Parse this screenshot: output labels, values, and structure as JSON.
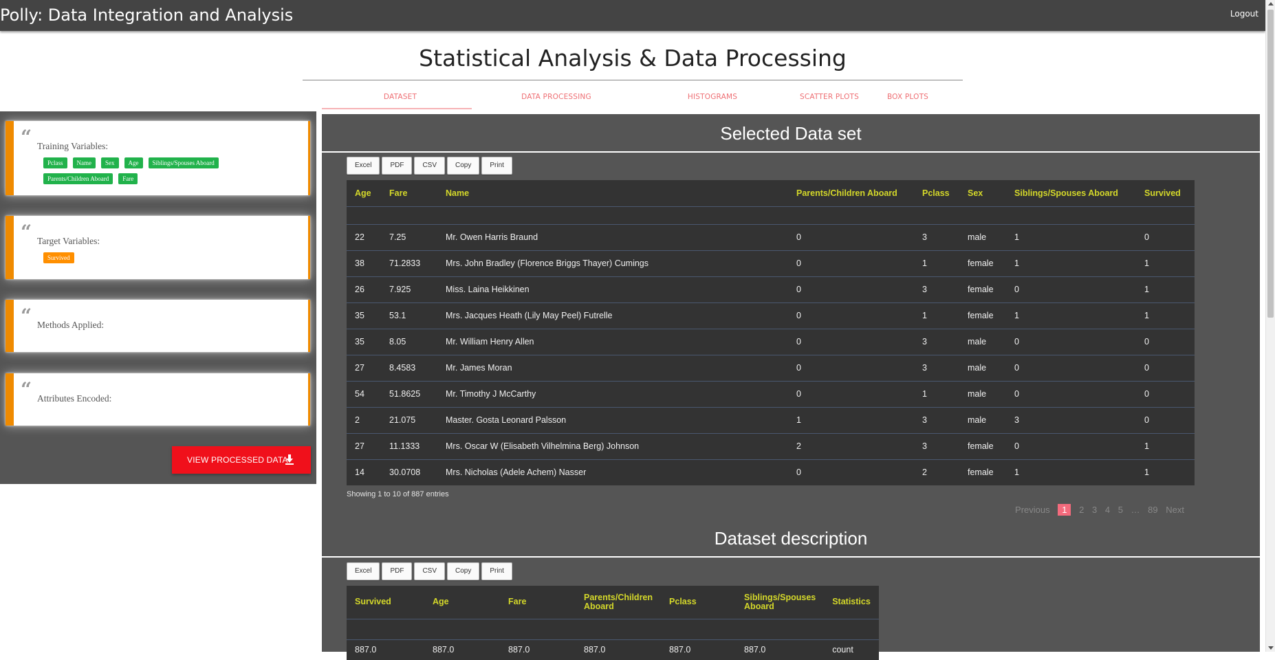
{
  "app": {
    "title": "Polly: Data Integration and Analysis",
    "logout": "Logout"
  },
  "page": {
    "title": "Statistical Analysis & Data Processing"
  },
  "tabs": [
    {
      "label": "DATASET",
      "active": true
    },
    {
      "label": "DATA PROCESSING"
    },
    {
      "label": "HISTOGRAMS"
    },
    {
      "label": "SCATTER PLOTS"
    },
    {
      "label": "BOX PLOTS"
    }
  ],
  "sidebar": {
    "training": {
      "title": "Training Variables:",
      "chips": [
        "Pclass",
        "Name",
        "Sex",
        "Age",
        "Siblings/Spouses Aboard",
        "Parents/Children Aboard",
        "Fare"
      ]
    },
    "target": {
      "title": "Target Variables:",
      "chips": [
        "Survived"
      ]
    },
    "methods": {
      "title": "Methods Applied:"
    },
    "encoded": {
      "title": "Attributes Encoded:"
    },
    "view_button": "VIEW PROCESSED DATA",
    "quote_glyph": "“"
  },
  "export_buttons": [
    "Excel",
    "PDF",
    "CSV",
    "Copy",
    "Print"
  ],
  "dataset": {
    "title": "Selected Data set",
    "columns": [
      "Age",
      "Fare",
      "Name",
      "Parents/Children Aboard",
      "Pclass",
      "Sex",
      "Siblings/Spouses Aboard",
      "Survived"
    ],
    "rows": [
      [
        "22",
        "7.25",
        "Mr. Owen Harris Braund",
        "0",
        "3",
        "male",
        "1",
        "0"
      ],
      [
        "38",
        "71.2833",
        "Mrs. John Bradley (Florence Briggs Thayer) Cumings",
        "0",
        "1",
        "female",
        "1",
        "1"
      ],
      [
        "26",
        "7.925",
        "Miss. Laina Heikkinen",
        "0",
        "3",
        "female",
        "0",
        "1"
      ],
      [
        "35",
        "53.1",
        "Mrs. Jacques Heath (Lily May Peel) Futrelle",
        "0",
        "1",
        "female",
        "1",
        "1"
      ],
      [
        "35",
        "8.05",
        "Mr. William Henry Allen",
        "0",
        "3",
        "male",
        "0",
        "0"
      ],
      [
        "27",
        "8.4583",
        "Mr. James Moran",
        "0",
        "3",
        "male",
        "0",
        "0"
      ],
      [
        "54",
        "51.8625",
        "Mr. Timothy J McCarthy",
        "0",
        "1",
        "male",
        "0",
        "0"
      ],
      [
        "2",
        "21.075",
        "Master. Gosta Leonard Palsson",
        "1",
        "3",
        "male",
        "3",
        "0"
      ],
      [
        "27",
        "11.1333",
        "Mrs. Oscar W (Elisabeth Vilhelmina Berg) Johnson",
        "2",
        "3",
        "female",
        "0",
        "1"
      ],
      [
        "14",
        "30.0708",
        "Mrs. Nicholas (Adele Achem) Nasser",
        "0",
        "2",
        "female",
        "1",
        "1"
      ]
    ],
    "info": "Showing 1 to 10 of 887 entries",
    "pagination": {
      "previous": "Previous",
      "pages": [
        "1",
        "2",
        "3",
        "4",
        "5",
        "…",
        "89"
      ],
      "next": "Next",
      "current": "1"
    }
  },
  "description": {
    "title": "Dataset description",
    "columns": [
      "Survived",
      "Age",
      "Fare",
      "Parents/Children Aboard",
      "Pclass",
      "Siblings/Spouses Aboard",
      "Statistics"
    ],
    "rows": [
      [
        "887.0",
        "887.0",
        "887.0",
        "887.0",
        "887.0",
        "887.0",
        "count"
      ]
    ]
  }
}
